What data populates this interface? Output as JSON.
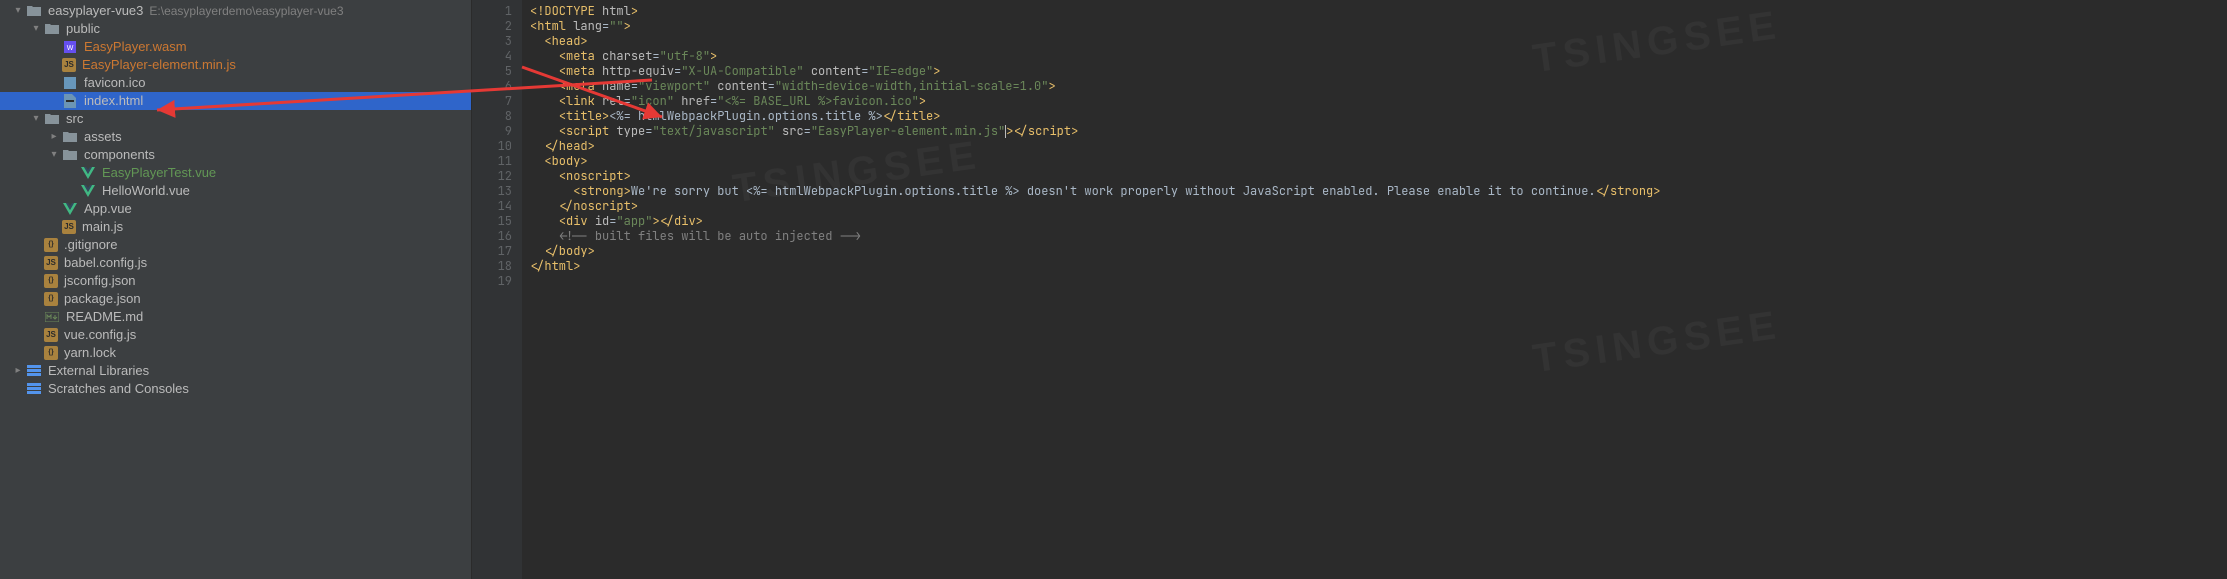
{
  "project": {
    "root": {
      "name": "easyplayer-vue3",
      "path": "E:\\easyplayerdemo\\easyplayer-vue3"
    },
    "nodes": [
      {
        "depth": 0,
        "chev": "down",
        "icon": "folder",
        "label": "easyplayer-vue3",
        "cls": "folder",
        "pathhint": "E:\\easyplayerdemo\\easyplayer-vue3"
      },
      {
        "depth": 1,
        "chev": "down",
        "icon": "folder",
        "label": "public",
        "cls": "folder"
      },
      {
        "depth": 2,
        "chev": "",
        "icon": "wasm",
        "label": "EasyPlayer.wasm",
        "cls": "orange"
      },
      {
        "depth": 2,
        "chev": "",
        "icon": "js",
        "label": "EasyPlayer-element.min.js",
        "cls": "orange"
      },
      {
        "depth": 2,
        "chev": "",
        "icon": "ico",
        "label": "favicon.ico"
      },
      {
        "depth": 2,
        "chev": "",
        "icon": "html",
        "label": "index.html",
        "selected": true
      },
      {
        "depth": 1,
        "chev": "down",
        "icon": "folder",
        "label": "src",
        "cls": "folder"
      },
      {
        "depth": 2,
        "chev": "right",
        "icon": "folder",
        "label": "assets",
        "cls": "folder"
      },
      {
        "depth": 2,
        "chev": "down",
        "icon": "folder",
        "label": "components",
        "cls": "folder"
      },
      {
        "depth": 3,
        "chev": "",
        "icon": "vue",
        "label": "EasyPlayerTest.vue",
        "cls": "green"
      },
      {
        "depth": 3,
        "chev": "",
        "icon": "vue",
        "label": "HelloWorld.vue"
      },
      {
        "depth": 2,
        "chev": "",
        "icon": "vue",
        "label": "App.vue"
      },
      {
        "depth": 2,
        "chev": "",
        "icon": "js",
        "label": "main.js"
      },
      {
        "depth": 1,
        "chev": "",
        "icon": "json",
        "label": ".gitignore"
      },
      {
        "depth": 1,
        "chev": "",
        "icon": "js",
        "label": "babel.config.js"
      },
      {
        "depth": 1,
        "chev": "",
        "icon": "json",
        "label": "jsconfig.json"
      },
      {
        "depth": 1,
        "chev": "",
        "icon": "json",
        "label": "package.json"
      },
      {
        "depth": 1,
        "chev": "",
        "icon": "md",
        "label": "README.md"
      },
      {
        "depth": 1,
        "chev": "",
        "icon": "js",
        "label": "vue.config.js"
      },
      {
        "depth": 1,
        "chev": "",
        "icon": "json",
        "label": "yarn.lock"
      },
      {
        "depth": 0,
        "chev": "right",
        "icon": "lib",
        "label": "External Libraries"
      },
      {
        "depth": 0,
        "chev": "",
        "icon": "lib",
        "label": "Scratches and Consoles"
      }
    ]
  },
  "editor": {
    "filename": "index.html",
    "lines": [
      [
        {
          "t": "br",
          "v": "<!DOCTYPE "
        },
        {
          "t": "attr",
          "v": "html"
        },
        {
          "t": "br",
          "v": ">"
        }
      ],
      [
        {
          "t": "br",
          "v": "<html "
        },
        {
          "t": "attr",
          "v": "lang"
        },
        {
          "t": "eq",
          "v": "="
        },
        {
          "t": "str",
          "v": "\"\""
        },
        {
          "t": "br",
          "v": ">"
        }
      ],
      [
        {
          "sp": 2
        },
        {
          "t": "br",
          "v": "<head>"
        }
      ],
      [
        {
          "sp": 4
        },
        {
          "t": "br",
          "v": "<meta "
        },
        {
          "t": "attr",
          "v": "charset"
        },
        {
          "t": "eq",
          "v": "="
        },
        {
          "t": "str",
          "v": "\"utf-8\""
        },
        {
          "t": "br",
          "v": ">"
        }
      ],
      [
        {
          "sp": 4
        },
        {
          "t": "br",
          "v": "<meta "
        },
        {
          "t": "attr",
          "v": "http-equiv"
        },
        {
          "t": "eq",
          "v": "="
        },
        {
          "t": "str",
          "v": "\"X-UA-Compatible\""
        },
        {
          "t": "txt",
          "v": " "
        },
        {
          "t": "attr",
          "v": "content"
        },
        {
          "t": "eq",
          "v": "="
        },
        {
          "t": "str",
          "v": "\"IE=edge\""
        },
        {
          "t": "br",
          "v": ">"
        }
      ],
      [
        {
          "sp": 4
        },
        {
          "t": "br",
          "v": "<meta "
        },
        {
          "t": "attr",
          "v": "name"
        },
        {
          "t": "eq",
          "v": "="
        },
        {
          "t": "str",
          "v": "\"viewport\""
        },
        {
          "t": "txt",
          "v": " "
        },
        {
          "t": "attr",
          "v": "content"
        },
        {
          "t": "eq",
          "v": "="
        },
        {
          "t": "str",
          "v": "\"width=device-width,initial-scale=1.0\""
        },
        {
          "t": "br",
          "v": ">"
        }
      ],
      [
        {
          "sp": 4
        },
        {
          "t": "br",
          "v": "<link "
        },
        {
          "t": "attr",
          "v": "rel"
        },
        {
          "t": "eq",
          "v": "="
        },
        {
          "t": "str",
          "v": "\"icon\""
        },
        {
          "t": "txt",
          "v": " "
        },
        {
          "t": "attr",
          "v": "href"
        },
        {
          "t": "eq",
          "v": "="
        },
        {
          "t": "str",
          "v": "\"<%= BASE_URL %>favicon.ico\""
        },
        {
          "t": "br",
          "v": ">"
        }
      ],
      [
        {
          "sp": 4
        },
        {
          "t": "br",
          "v": "<title>"
        },
        {
          "t": "txt",
          "v": "<%= htmlWebpackPlugin.options.title %>"
        },
        {
          "t": "br",
          "v": "</title>"
        }
      ],
      [
        {
          "sp": 4
        },
        {
          "t": "br",
          "v": "<script "
        },
        {
          "t": "attr",
          "v": "type"
        },
        {
          "t": "eq",
          "v": "="
        },
        {
          "t": "str",
          "v": "\"text/javascript\""
        },
        {
          "t": "txt",
          "v": " "
        },
        {
          "t": "attr",
          "v": "src"
        },
        {
          "t": "eq",
          "v": "="
        },
        {
          "t": "str",
          "v": "\"EasyPlayer-element.min.js\""
        },
        {
          "caret": true
        },
        {
          "t": "br",
          "v": ">"
        },
        {
          "t": "br",
          "v": "</script>"
        }
      ],
      [
        {
          "sp": 2
        },
        {
          "t": "br",
          "v": "</head>"
        }
      ],
      [
        {
          "sp": 2
        },
        {
          "t": "br",
          "v": "<body>"
        }
      ],
      [
        {
          "sp": 4
        },
        {
          "t": "br",
          "v": "<noscript>"
        }
      ],
      [
        {
          "sp": 6
        },
        {
          "t": "br",
          "v": "<strong>"
        },
        {
          "t": "txt",
          "v": "We're sorry but <%= htmlWebpackPlugin.options.title %> doesn't work properly without JavaScript enabled. Please enable it to continue."
        },
        {
          "t": "br",
          "v": "</strong>"
        }
      ],
      [
        {
          "sp": 4
        },
        {
          "t": "br",
          "v": "</noscript>"
        }
      ],
      [
        {
          "sp": 4
        },
        {
          "t": "br",
          "v": "<div "
        },
        {
          "t": "attr",
          "v": "id"
        },
        {
          "t": "eq",
          "v": "="
        },
        {
          "t": "str",
          "v": "\"app\""
        },
        {
          "t": "br",
          "v": ">"
        },
        {
          "t": "br",
          "v": "</div>"
        }
      ],
      [
        {
          "sp": 4
        },
        {
          "t": "cmt",
          "v": "<!-- built files will be auto injected -->"
        }
      ],
      [
        {
          "sp": 2
        },
        {
          "t": "br",
          "v": "</body>"
        }
      ],
      [
        {
          "t": "br",
          "v": "</html>"
        }
      ],
      []
    ]
  }
}
